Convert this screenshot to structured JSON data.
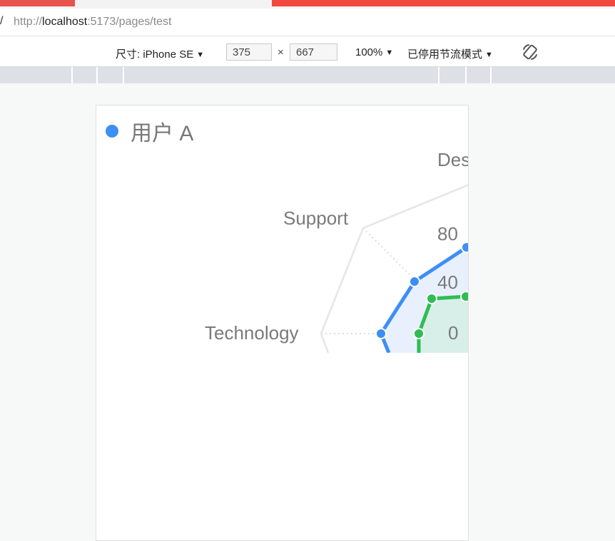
{
  "browser": {
    "address_icon": "/",
    "url_scheme": "http://",
    "url_host": "localhost",
    "url_rest": ":5173/pages/test"
  },
  "device_toolbar": {
    "device_label": "尺寸: iPhone SE",
    "width": "375",
    "times": "×",
    "height": "667",
    "zoom": "100%",
    "throttle": "已停用节流模式",
    "caret": "▼",
    "rotate_icon": "rotate-icon"
  },
  "radar": {
    "legend": {
      "label": "用户 A",
      "color": "#3d8ef7"
    },
    "axis_labels": [
      "Des",
      "Support",
      "Technology"
    ],
    "ticks": [
      "80",
      "40",
      "0"
    ],
    "colors": {
      "series_a": "#3d8ef7",
      "series_b": "#2fbd52",
      "grid": "#e6e6e6"
    }
  }
}
